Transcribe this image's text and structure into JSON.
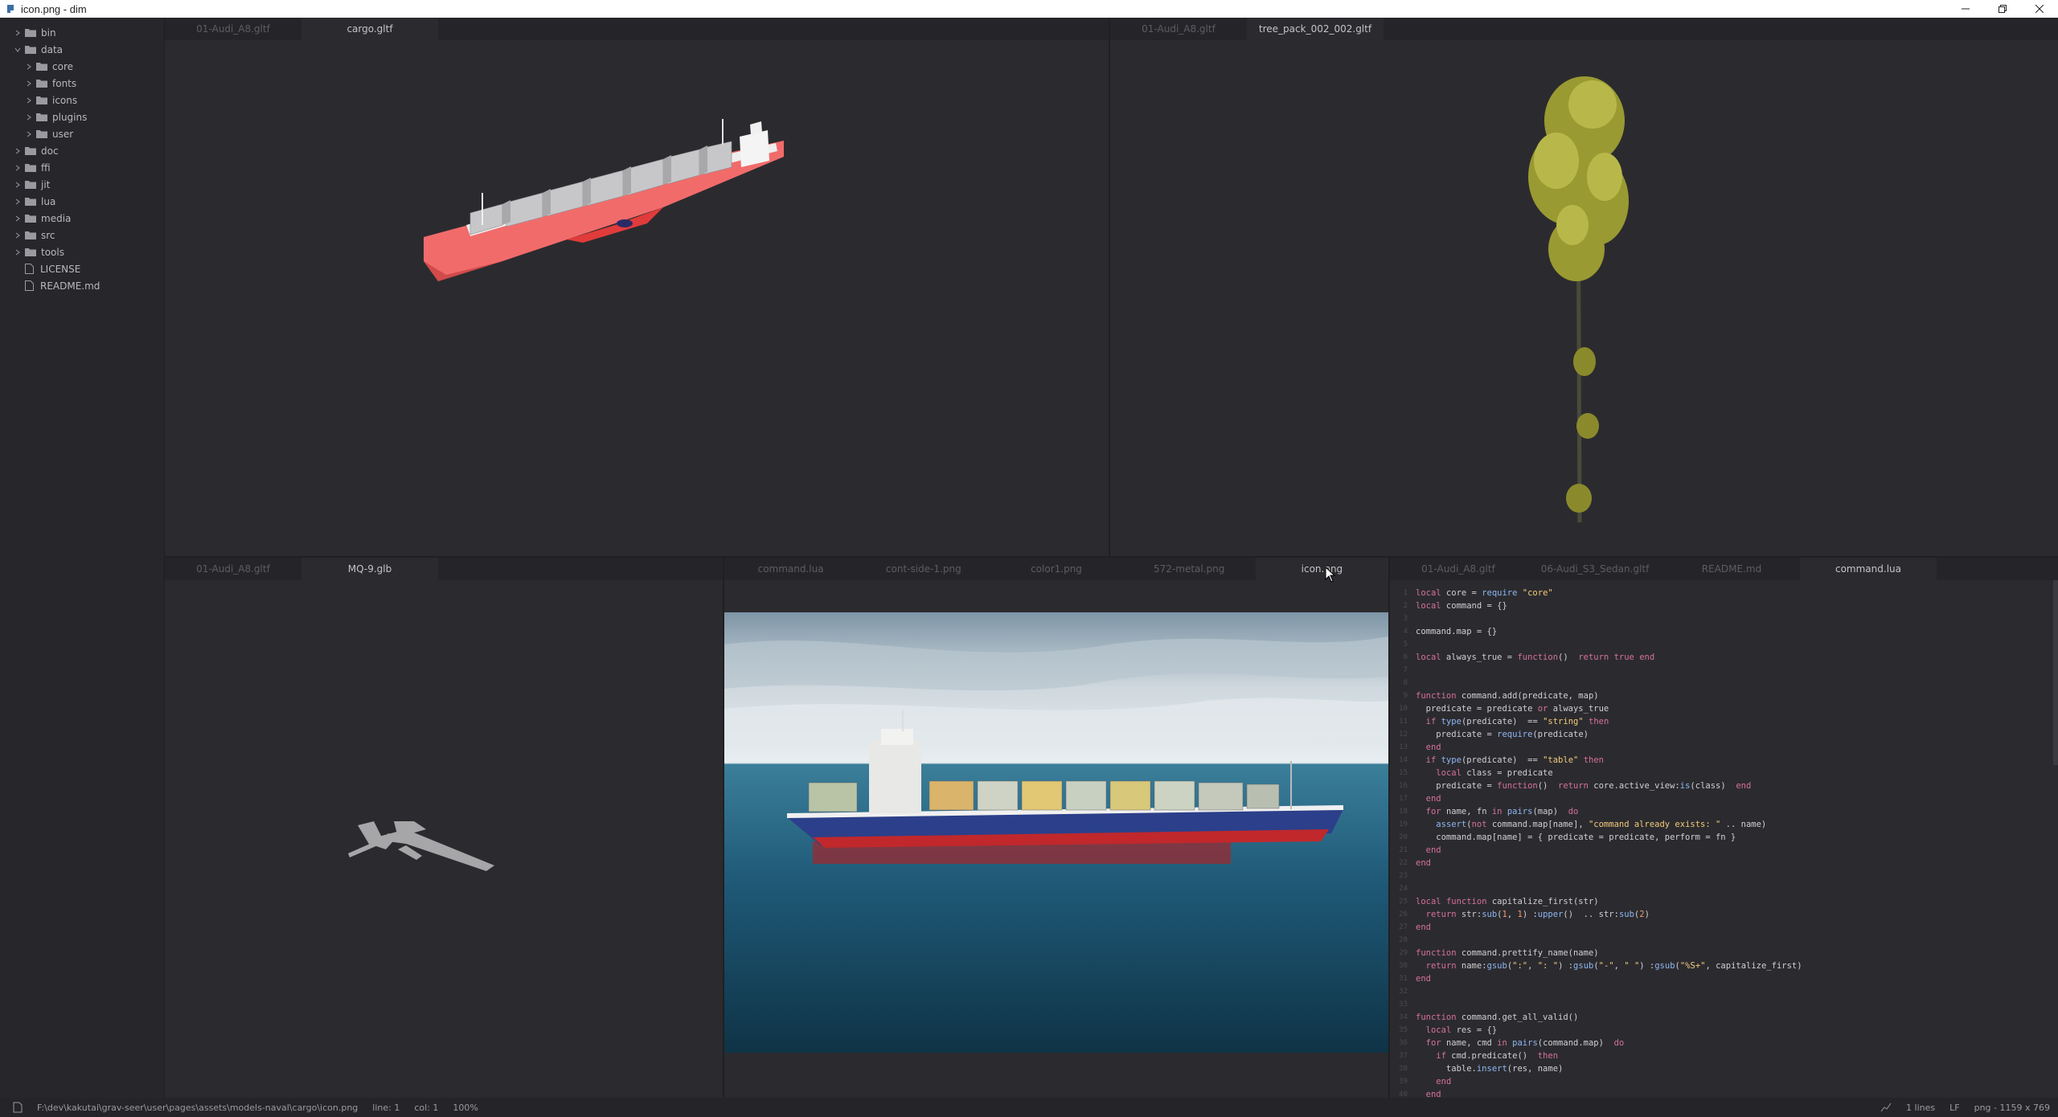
{
  "window": {
    "title": "icon.png - dim"
  },
  "sidebar": {
    "items": [
      {
        "label": "bin",
        "type": "folder",
        "level": 0,
        "expanded": false
      },
      {
        "label": "data",
        "type": "folder",
        "level": 0,
        "expanded": true
      },
      {
        "label": "core",
        "type": "folder",
        "level": 1,
        "expanded": false
      },
      {
        "label": "fonts",
        "type": "folder",
        "level": 1,
        "expanded": false
      },
      {
        "label": "icons",
        "type": "folder",
        "level": 1,
        "expanded": false
      },
      {
        "label": "plugins",
        "type": "folder",
        "level": 1,
        "expanded": false
      },
      {
        "label": "user",
        "type": "folder",
        "level": 1,
        "expanded": false
      },
      {
        "label": "doc",
        "type": "folder",
        "level": 0,
        "expanded": false
      },
      {
        "label": "ffi",
        "type": "folder",
        "level": 0,
        "expanded": false
      },
      {
        "label": "jit",
        "type": "folder",
        "level": 0,
        "expanded": false
      },
      {
        "label": "lua",
        "type": "folder",
        "level": 0,
        "expanded": false
      },
      {
        "label": "media",
        "type": "folder",
        "level": 0,
        "expanded": false
      },
      {
        "label": "src",
        "type": "folder",
        "level": 0,
        "expanded": false
      },
      {
        "label": "tools",
        "type": "folder",
        "level": 0,
        "expanded": false
      },
      {
        "label": "LICENSE",
        "type": "file",
        "level": 0
      },
      {
        "label": "README.md",
        "type": "file",
        "level": 0
      }
    ]
  },
  "panes": {
    "top_left": {
      "tabs": [
        "01-Audi_A8.gltf",
        "cargo.gltf"
      ],
      "active": 1
    },
    "top_right": {
      "tabs": [
        "01-Audi_A8.gltf",
        "tree_pack_002_002.gltf"
      ],
      "active": 1
    },
    "bottom_left": {
      "tabs": [
        "01-Audi_A8.gltf",
        "MQ-9.glb"
      ],
      "active": 1
    },
    "bottom_mid": {
      "tabs": [
        "command.lua",
        "cont-side-1.png",
        "color1.png",
        "572-metal.png",
        "icon.png"
      ],
      "active": 4
    },
    "bottom_right": {
      "tabs": [
        "01-Audi_A8.gltf",
        "06-Audi_S3_Sedan.gltf",
        "README.md",
        "command.lua"
      ],
      "active": 3
    }
  },
  "code": {
    "lines": [
      "local core = require \"core\"",
      "local command = {}",
      "",
      "command.map = {}",
      "",
      "local always_true = function()  return true end",
      "",
      "",
      "function command.add(predicate, map)",
      "  predicate = predicate or always_true",
      "  if type(predicate)  == \"string\" then",
      "    predicate = require(predicate)",
      "  end",
      "  if type(predicate)  == \"table\" then",
      "    local class = predicate",
      "    predicate = function()  return core.active_view:is(class)  end",
      "  end",
      "  for name, fn in pairs(map)  do",
      "    assert(not command.map[name], \"command already exists: \" .. name)",
      "    command.map[name] = { predicate = predicate, perform = fn }",
      "  end",
      "end",
      "",
      "",
      "local function capitalize_first(str)",
      "  return str:sub(1, 1) :upper()  .. str:sub(2)",
      "end",
      "",
      "function command.prettify_name(name)",
      "  return name:gsub(\":\", \": \") :gsub(\"-\", \" \") :gsub(\"%S+\", capitalize_first)",
      "end",
      "",
      "",
      "function command.get_all_valid()",
      "  local res = {}",
      "  for name, cmd in pairs(command.map)  do",
      "    if cmd.predicate()  then",
      "      table.insert(res, name)",
      "    end",
      "  end"
    ]
  },
  "status": {
    "path": "F:\\dev\\kakutai\\grav-seer\\user\\pages\\assets\\models-naval\\cargo\\icon.png",
    "line": "line: 1",
    "col": "col: 1",
    "zoom": "100%",
    "lines_count": "1 lines",
    "eol": "LF",
    "file_info": "png - 1159 x 769"
  },
  "colors": {
    "accent_ship_hull": "#f26b6b",
    "tree_foliage": "#a8a83a",
    "sea": "#1f5a78"
  }
}
